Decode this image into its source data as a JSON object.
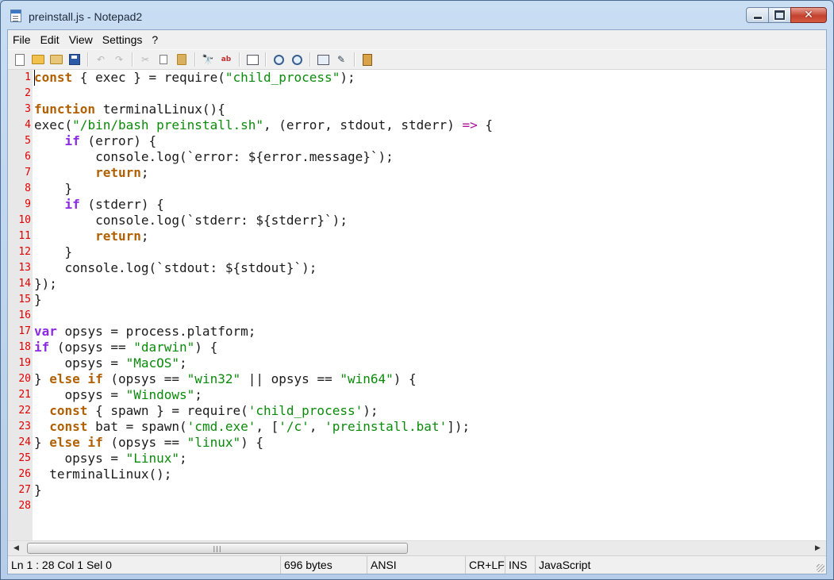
{
  "window": {
    "title": "preinstall.js - Notepad2",
    "icon": "notepad-icon"
  },
  "menu": [
    "File",
    "Edit",
    "View",
    "Settings",
    "?"
  ],
  "toolbar": [
    "new-icon",
    "open-icon",
    "browse-icon",
    "save-icon",
    "undo-icon",
    "redo-icon",
    "cut-icon",
    "copy-icon",
    "paste-icon",
    "find-icon",
    "replace-icon",
    "word-wrap-icon",
    "zoom-in-icon",
    "zoom-out-icon",
    "scheme-icon",
    "customize-icon",
    "exit-icon"
  ],
  "editor": {
    "lines": [
      {
        "n": "1",
        "tokens": [
          {
            "t": "const",
            "c": "kw2"
          },
          {
            "t": " { exec } = require(",
            "c": ""
          },
          {
            "t": "\"child_process\"",
            "c": "str"
          },
          {
            "t": ");",
            "c": ""
          }
        ]
      },
      {
        "n": "2",
        "tokens": []
      },
      {
        "n": "3",
        "tokens": [
          {
            "t": "function",
            "c": "kw2"
          },
          {
            "t": " terminalLinux(){",
            "c": ""
          }
        ]
      },
      {
        "n": "4",
        "tokens": [
          {
            "t": "exec(",
            "c": ""
          },
          {
            "t": "\"/bin/bash preinstall.sh\"",
            "c": "str"
          },
          {
            "t": ", (error, stdout, stderr) ",
            "c": ""
          },
          {
            "t": "=>",
            "c": "op"
          },
          {
            "t": " {",
            "c": ""
          }
        ]
      },
      {
        "n": "5",
        "tokens": [
          {
            "t": "    ",
            "c": ""
          },
          {
            "t": "if",
            "c": "kw"
          },
          {
            "t": " (error) {",
            "c": ""
          }
        ]
      },
      {
        "n": "6",
        "tokens": [
          {
            "t": "        console.log(`error: ${error.message}`);",
            "c": ""
          }
        ]
      },
      {
        "n": "7",
        "tokens": [
          {
            "t": "        ",
            "c": ""
          },
          {
            "t": "return",
            "c": "kw2"
          },
          {
            "t": ";",
            "c": ""
          }
        ]
      },
      {
        "n": "8",
        "tokens": [
          {
            "t": "    }",
            "c": ""
          }
        ]
      },
      {
        "n": "9",
        "tokens": [
          {
            "t": "    ",
            "c": ""
          },
          {
            "t": "if",
            "c": "kw"
          },
          {
            "t": " (stderr) {",
            "c": ""
          }
        ]
      },
      {
        "n": "10",
        "tokens": [
          {
            "t": "        console.log(`stderr: ${stderr}`);",
            "c": ""
          }
        ]
      },
      {
        "n": "11",
        "tokens": [
          {
            "t": "        ",
            "c": ""
          },
          {
            "t": "return",
            "c": "kw2"
          },
          {
            "t": ";",
            "c": ""
          }
        ]
      },
      {
        "n": "12",
        "tokens": [
          {
            "t": "    }",
            "c": ""
          }
        ]
      },
      {
        "n": "13",
        "tokens": [
          {
            "t": "    console.log(`stdout: ${stdout}`);",
            "c": ""
          }
        ]
      },
      {
        "n": "14",
        "tokens": [
          {
            "t": "});",
            "c": ""
          }
        ]
      },
      {
        "n": "15",
        "tokens": [
          {
            "t": "}",
            "c": ""
          }
        ]
      },
      {
        "n": "16",
        "tokens": []
      },
      {
        "n": "17",
        "tokens": [
          {
            "t": "var",
            "c": "kw"
          },
          {
            "t": " opsys = process.platform;",
            "c": ""
          }
        ]
      },
      {
        "n": "18",
        "tokens": [
          {
            "t": "if",
            "c": "kw"
          },
          {
            "t": " (opsys == ",
            "c": ""
          },
          {
            "t": "\"darwin\"",
            "c": "str"
          },
          {
            "t": ") {",
            "c": ""
          }
        ]
      },
      {
        "n": "19",
        "tokens": [
          {
            "t": "    opsys = ",
            "c": ""
          },
          {
            "t": "\"MacOS\"",
            "c": "str"
          },
          {
            "t": ";",
            "c": ""
          }
        ]
      },
      {
        "n": "20",
        "tokens": [
          {
            "t": "} ",
            "c": ""
          },
          {
            "t": "else if",
            "c": "kw2"
          },
          {
            "t": " (opsys == ",
            "c": ""
          },
          {
            "t": "\"win32\"",
            "c": "str"
          },
          {
            "t": " || opsys == ",
            "c": ""
          },
          {
            "t": "\"win64\"",
            "c": "str"
          },
          {
            "t": ") {",
            "c": ""
          }
        ]
      },
      {
        "n": "21",
        "tokens": [
          {
            "t": "    opsys = ",
            "c": ""
          },
          {
            "t": "\"Windows\"",
            "c": "str"
          },
          {
            "t": ";",
            "c": ""
          }
        ]
      },
      {
        "n": "22",
        "tokens": [
          {
            "t": "  ",
            "c": ""
          },
          {
            "t": "const",
            "c": "kw2"
          },
          {
            "t": " { spawn } = require(",
            "c": ""
          },
          {
            "t": "'child_process'",
            "c": "str"
          },
          {
            "t": ");",
            "c": ""
          }
        ]
      },
      {
        "n": "23",
        "tokens": [
          {
            "t": "  ",
            "c": ""
          },
          {
            "t": "const",
            "c": "kw2"
          },
          {
            "t": " bat = spawn(",
            "c": ""
          },
          {
            "t": "'cmd.exe'",
            "c": "str"
          },
          {
            "t": ", [",
            "c": ""
          },
          {
            "t": "'/c'",
            "c": "str"
          },
          {
            "t": ", ",
            "c": ""
          },
          {
            "t": "'preinstall.bat'",
            "c": "str"
          },
          {
            "t": "]);",
            "c": ""
          }
        ]
      },
      {
        "n": "24",
        "tokens": [
          {
            "t": "} ",
            "c": ""
          },
          {
            "t": "else if",
            "c": "kw2"
          },
          {
            "t": " (opsys == ",
            "c": ""
          },
          {
            "t": "\"linux\"",
            "c": "str"
          },
          {
            "t": ") {",
            "c": ""
          }
        ]
      },
      {
        "n": "25",
        "tokens": [
          {
            "t": "    opsys = ",
            "c": ""
          },
          {
            "t": "\"Linux\"",
            "c": "str"
          },
          {
            "t": ";",
            "c": ""
          }
        ]
      },
      {
        "n": "26",
        "tokens": [
          {
            "t": "  terminalLinux();",
            "c": ""
          }
        ]
      },
      {
        "n": "27",
        "tokens": [
          {
            "t": "}",
            "c": ""
          }
        ]
      },
      {
        "n": "28",
        "tokens": []
      }
    ]
  },
  "status": {
    "position": "Ln 1 : 28   Col 1   Sel 0",
    "size": "696 bytes",
    "encoding": "ANSI",
    "eol": "CR+LF",
    "mode": "INS",
    "lexer": "JavaScript"
  },
  "colors": {
    "keyword": "#8a2be2",
    "keyword2": "#b06000",
    "string": "#0a8a0a",
    "operator": "#b0109a",
    "line_number": "#e00000"
  }
}
